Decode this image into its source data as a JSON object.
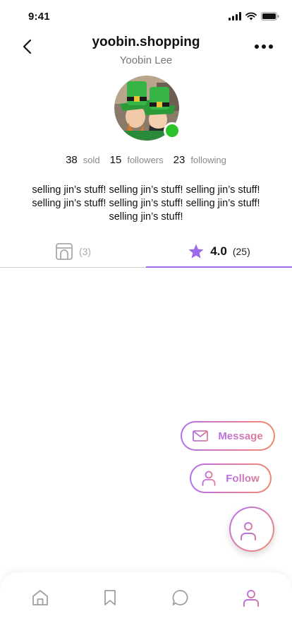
{
  "status_bar": {
    "time": "9:41",
    "icons": [
      "signal-icon",
      "wifi-icon",
      "battery-icon"
    ]
  },
  "header": {
    "username": "yoobin.shopping",
    "real_name": "Yoobin Lee",
    "back_icon": "chevron-left-icon",
    "more_icon": "more-horizontal-icon"
  },
  "profile": {
    "online": true,
    "online_color": "#2bc22b"
  },
  "stats": [
    {
      "value": "38",
      "label": "sold"
    },
    {
      "value": "15",
      "label": "followers"
    },
    {
      "value": "23",
      "label": "following"
    }
  ],
  "bio": "selling jin’s stuff! selling jin’s stuff! selling jin’s stuff! selling jin’s stuff! selling jin’s stuff! selling jin’s stuff! selling jin’s stuff!",
  "tabs": {
    "listings": {
      "icon": "storefront-icon",
      "count": "(3)"
    },
    "reviews": {
      "icon": "star-icon",
      "rating": "4.0",
      "count": "(25)",
      "active": true
    }
  },
  "actions": {
    "message_label": "Message",
    "follow_label": "Follow",
    "fab_icon": "add-user-icon"
  },
  "bottom_nav": [
    {
      "name": "home",
      "icon": "home-icon"
    },
    {
      "name": "saved",
      "icon": "bookmark-icon"
    },
    {
      "name": "messages",
      "icon": "chat-icon"
    },
    {
      "name": "profile",
      "icon": "user-icon",
      "active": true
    }
  ],
  "colors": {
    "accent": "#9b6bea",
    "gradient_start": "#b071ee",
    "gradient_end": "#f08a6c",
    "inactive": "#a0a0a0"
  }
}
